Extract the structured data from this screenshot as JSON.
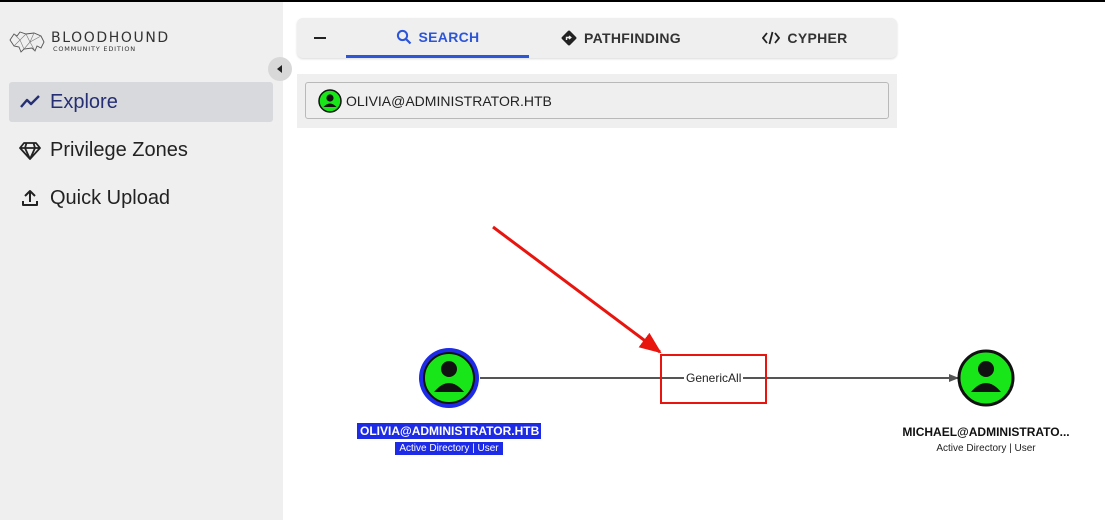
{
  "app": {
    "logo_title": "BLOODHOUND",
    "logo_subtitle": "COMMUNITY EDITION"
  },
  "sidebar": {
    "items": [
      {
        "label": "Explore",
        "icon": "trend-line-icon",
        "active": true
      },
      {
        "label": "Privilege Zones",
        "icon": "diamond-icon",
        "active": false
      },
      {
        "label": "Quick Upload",
        "icon": "upload-icon",
        "active": false
      }
    ]
  },
  "search": {
    "tabs": [
      {
        "label": "SEARCH",
        "icon": "search-icon",
        "active": true
      },
      {
        "label": "PATHFINDING",
        "icon": "pathfinding-icon",
        "active": false
      },
      {
        "label": "CYPHER",
        "icon": "code-icon",
        "active": false
      }
    ],
    "value": "OLIVIA@ADMINISTRATOR.HTB"
  },
  "graph": {
    "nodes": [
      {
        "name": "OLIVIA@ADMINISTRATOR.HTB",
        "type": "Active Directory | User",
        "selected": true
      },
      {
        "name": "MICHAEL@ADMINISTRATO...",
        "type": "Active Directory | User",
        "selected": false
      }
    ],
    "edge": {
      "label": "GenericAll"
    },
    "colors": {
      "node_fill": "#19e619",
      "selected_ring": "#1d2be6",
      "highlight": "#e8150f",
      "accent": "#2d55d8"
    }
  }
}
